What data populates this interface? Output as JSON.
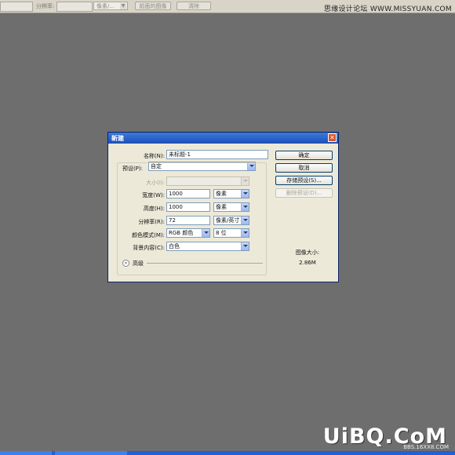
{
  "options_bar": {
    "resolution_label": "分辨率:",
    "units_select": "像素/...",
    "front_image_button": "前面的图像",
    "clear_button": "清除"
  },
  "watermark_top": "思缘设计论坛 WWW.MISSYUAN.COM",
  "dialog": {
    "title": "新建",
    "close_glyph": "✕",
    "name_label": "名称(N):",
    "name_value": "未标题-1",
    "preset_label": "预设(P):",
    "preset_value": "自定",
    "size_label": "大小(I):",
    "size_value": "",
    "width_label": "宽度(W):",
    "width_value": "1000",
    "width_unit": "像素",
    "height_label": "高度(H):",
    "height_value": "1000",
    "height_unit": "像素",
    "resolution_label": "分辨率(R):",
    "resolution_value": "72",
    "resolution_unit": "像素/英寸",
    "color_mode_label": "颜色模式(M):",
    "color_mode_value": "RGB 颜色",
    "bit_depth_value": "8 位",
    "bg_label": "背景内容(C):",
    "bg_value": "白色",
    "advanced_label": "高级",
    "advanced_glyph": "»",
    "ok_button": "确定",
    "cancel_button": "取消",
    "save_preset_button": "存储预设(S)...",
    "delete_preset_button": "删除预设(D)...",
    "image_size_label": "图像大小:",
    "image_size_value": "2.86M"
  },
  "watermark_bottom": "UiBQ.CoM",
  "watermark_bottom_sub": "BBS.16XX8.COM"
}
